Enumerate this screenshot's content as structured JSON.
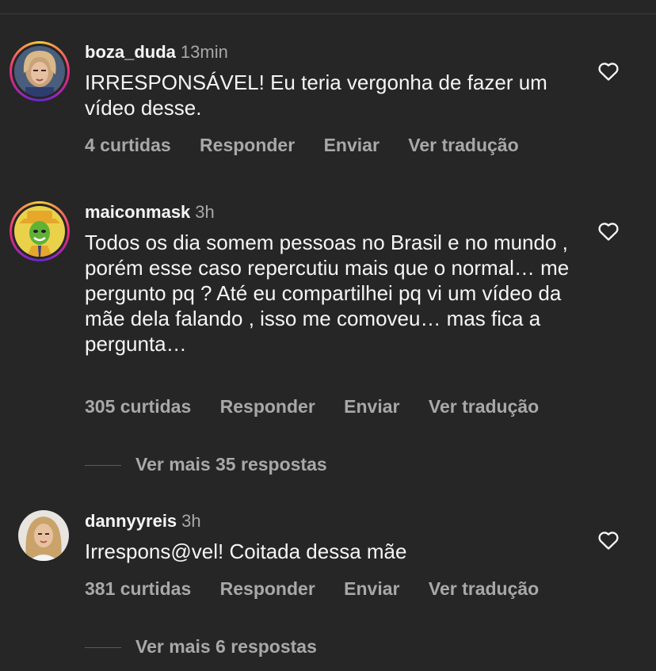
{
  "comments": [
    {
      "username": "boza_duda",
      "time": "13min",
      "text": "IRRESPONSÁVEL! Eu teria vergonha de fazer um vídeo desse.",
      "likes": "4 curtidas",
      "reply": "Responder",
      "send": "Enviar",
      "translate": "Ver tradução",
      "avatar_icon": "woman-portrait-avatar"
    },
    {
      "username": "maiconmask",
      "time": "3h",
      "text": "Todos os dia somem pessoas no Brasil e no mundo , porém esse caso repercutiu mais que o normal… me pergunto pq ? Até eu compartilhei pq vi um vídeo da mãe dela falando , isso me comoveu…  mas fica a pergunta…",
      "likes": "305 curtidas",
      "reply": "Responder",
      "send": "Enviar",
      "translate": "Ver tradução",
      "more_replies": "Ver mais 35 respostas",
      "avatar_icon": "green-mask-avatar"
    },
    {
      "username": "dannyyreis",
      "time": "3h",
      "text": "Irrespons@vel! Coitada dessa mãe",
      "likes": "381 curtidas",
      "reply": "Responder",
      "send": "Enviar",
      "translate": "Ver tradução",
      "more_replies": "Ver mais 6 respostas",
      "avatar_icon": "woman-portrait-avatar"
    }
  ],
  "colors": {
    "background": "#262626",
    "primary_text": "#f5f5f5",
    "secondary_text": "#a8a8a8"
  }
}
